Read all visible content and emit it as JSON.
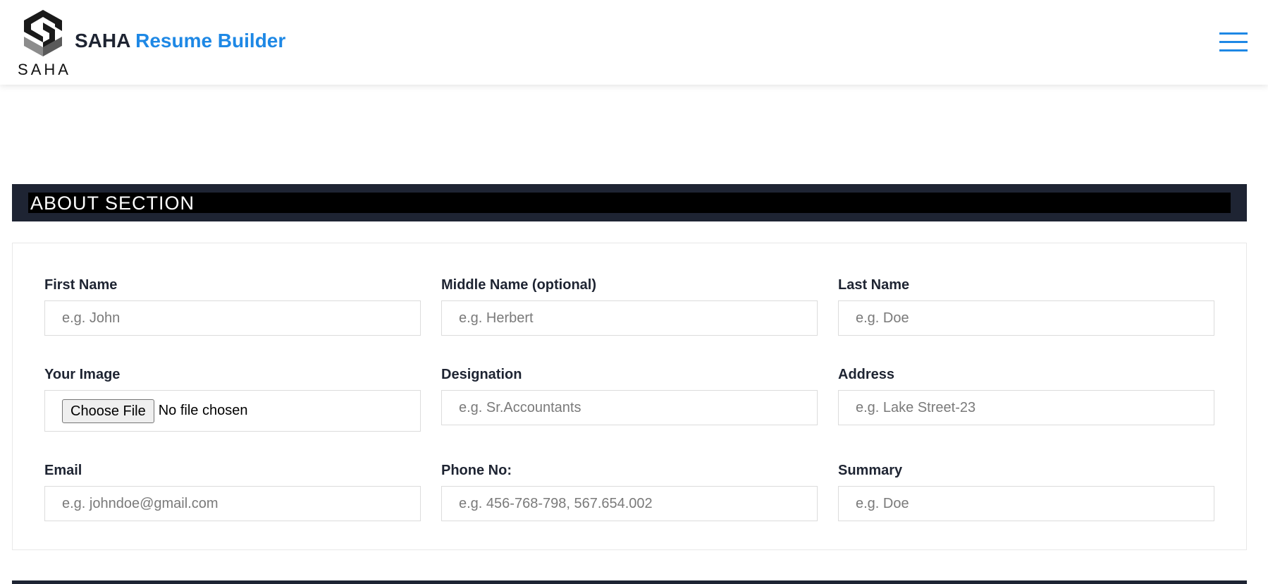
{
  "header": {
    "logo_word": "SAHA",
    "brand_primary": "SAHA",
    "brand_accent": "Resume Builder",
    "menu_icon": "hamburger-menu-icon",
    "accent_color": "#1e88e5",
    "text_color": "#1e2432"
  },
  "section": {
    "title": "ABOUT SECTION",
    "bar_color": "#1e2433"
  },
  "form": {
    "first_name": {
      "label": "First Name",
      "placeholder": "e.g. John",
      "value": ""
    },
    "middle_name": {
      "label": "Middle Name (optional)",
      "placeholder": "e.g. Herbert",
      "value": ""
    },
    "last_name": {
      "label": "Last Name",
      "placeholder": "e.g. Doe",
      "value": ""
    },
    "image": {
      "label": "Your Image",
      "button_label": "Choose File",
      "status": "No file chosen"
    },
    "designation": {
      "label": "Designation",
      "placeholder": "e.g. Sr.Accountants",
      "value": ""
    },
    "address": {
      "label": "Address",
      "placeholder": "e.g. Lake Street-23",
      "value": ""
    },
    "email": {
      "label": "Email",
      "placeholder": "e.g. johndoe@gmail.com",
      "value": ""
    },
    "phone": {
      "label": "Phone No:",
      "placeholder": "e.g. 456-768-798, 567.654.002",
      "value": ""
    },
    "summary": {
      "label": "Summary",
      "placeholder": "e.g. Doe",
      "value": ""
    }
  }
}
